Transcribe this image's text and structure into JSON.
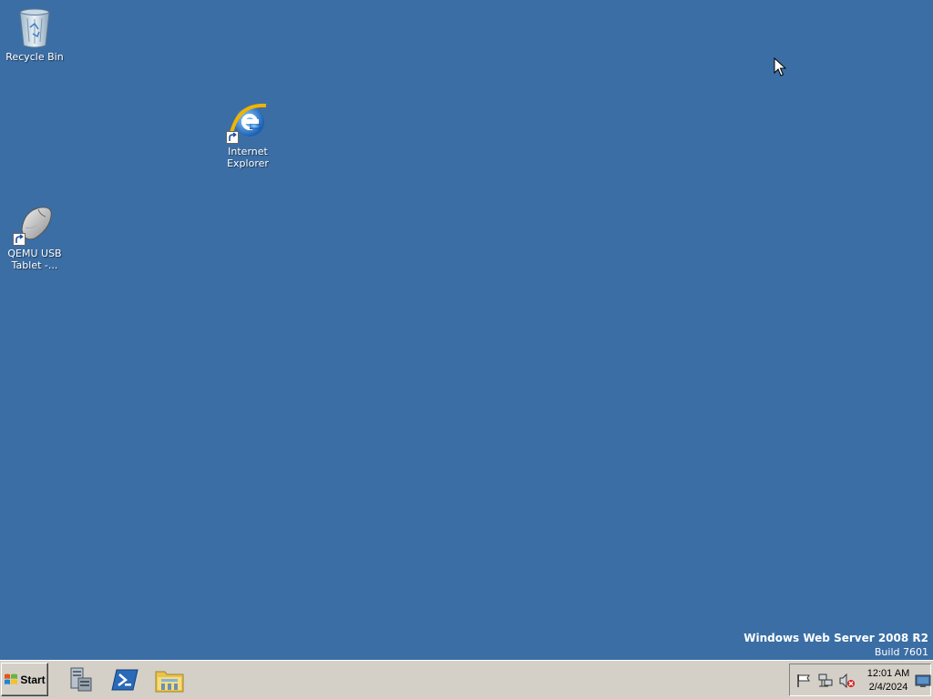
{
  "desktop": {
    "background_color": "#3b6ea5",
    "icons": [
      {
        "label": "Recycle Bin",
        "icon": "recycle-bin-icon"
      },
      {
        "label": "Internet Explorer",
        "icon": "internet-explorer-icon",
        "shortcut": true
      },
      {
        "label": "QEMU USB Tablet -...",
        "icon": "usb-tablet-icon",
        "shortcut": true
      }
    ],
    "watermark": {
      "title": "Windows Web Server 2008 R2",
      "build": "Build 7601"
    }
  },
  "taskbar": {
    "start_label": "Start",
    "pinned": [
      {
        "icon": "server-manager-icon"
      },
      {
        "icon": "powershell-icon"
      },
      {
        "icon": "windows-explorer-icon"
      }
    ],
    "tray": {
      "icons": [
        "action-center-flag-icon",
        "network-icon",
        "volume-muted-icon",
        "show-desktop-icon"
      ],
      "time": "12:01 AM",
      "date": "2/4/2024"
    }
  }
}
